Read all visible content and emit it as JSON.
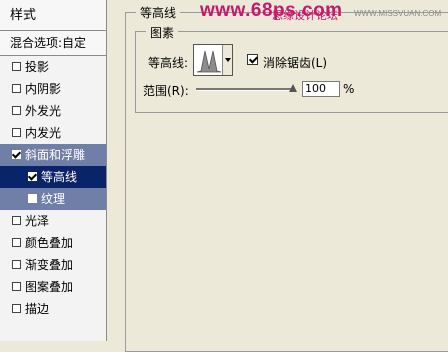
{
  "watermark": {
    "site": "www.68ps.com",
    "cn": "思缘设计论坛",
    "url": "WWW.MISSVUAN.COM"
  },
  "styles_panel": {
    "title": "样式",
    "blend_options": "混合选项:自定",
    "items": [
      {
        "label": "投影",
        "checked": false
      },
      {
        "label": "内阴影",
        "checked": false
      },
      {
        "label": "外发光",
        "checked": false
      },
      {
        "label": "内发光",
        "checked": false
      },
      {
        "label": "斜面和浮雕",
        "checked": true
      },
      {
        "label": "等高线",
        "checked": true
      },
      {
        "label": "纹理",
        "checked": false
      },
      {
        "label": "光泽",
        "checked": false
      },
      {
        "label": "颜色叠加",
        "checked": false
      },
      {
        "label": "渐变叠加",
        "checked": false
      },
      {
        "label": "图案叠加",
        "checked": false
      },
      {
        "label": "描边",
        "checked": false
      }
    ]
  },
  "contour_section": {
    "title": "等高线",
    "elements_title": "图素",
    "contour_label": "等高线:",
    "antialias_label": "消除锯齿(L)",
    "antialias_checked": true,
    "range_label": "范围(R):",
    "range_value": "100",
    "range_unit": "%"
  },
  "colors": {
    "selected_bg": "#0a246a",
    "highlight_bg": "#6f7fa8",
    "watermark": "#c8186d"
  }
}
